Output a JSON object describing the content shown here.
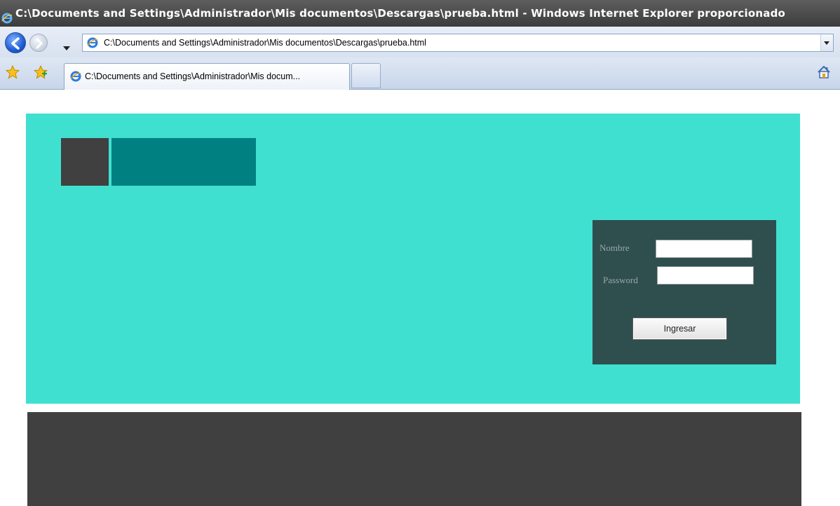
{
  "window": {
    "title": "C:\\Documents and Settings\\Administrador\\Mis documentos\\Descargas\\prueba.html - Windows Internet Explorer proporcionado"
  },
  "address_bar": {
    "url": "C:\\Documents and Settings\\Administrador\\Mis documentos\\Descargas\\prueba.html"
  },
  "tabs": [
    {
      "label": "C:\\Documents and Settings\\Administrador\\Mis docum..."
    }
  ],
  "login": {
    "nombre_label": "Nombre",
    "nombre_value": "",
    "password_label": "Password",
    "password_value": "",
    "submit_label": "Ingresar"
  },
  "colors": {
    "header_band": "#40e0d0",
    "logo_dark": "#404040",
    "logo_teal": "#008080",
    "login_box": "#2f4f4f",
    "footer_band": "#404040"
  }
}
